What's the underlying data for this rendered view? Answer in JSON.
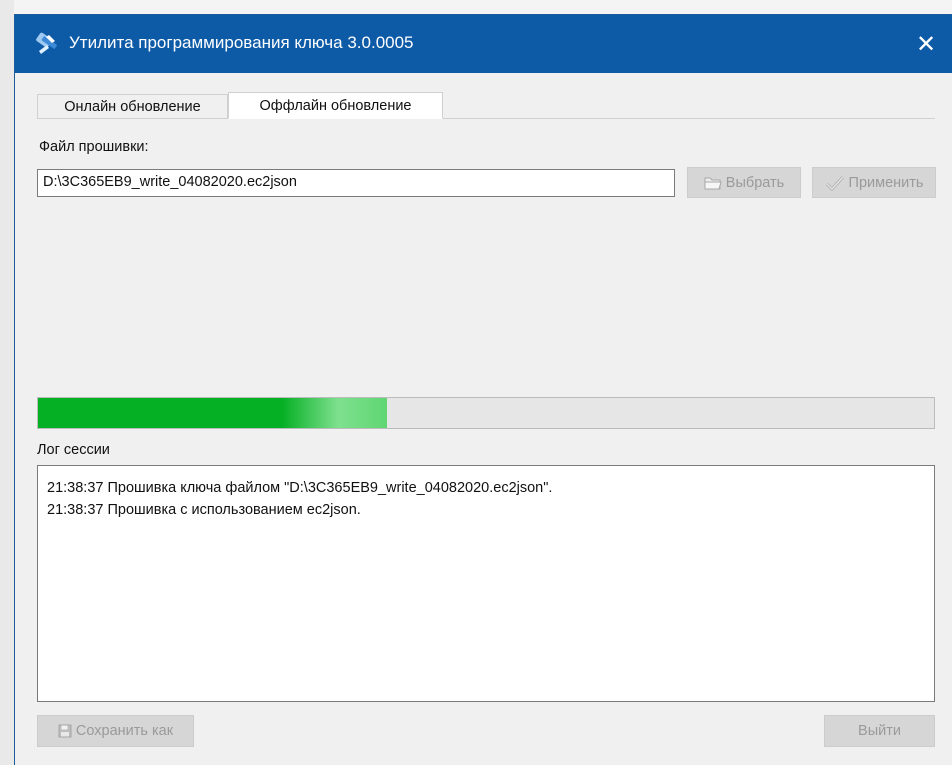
{
  "window": {
    "title": "Утилита программирования ключа 3.0.0005",
    "close_glyph": "✕"
  },
  "tabs": [
    {
      "label": "Онлайн обновление",
      "active": false
    },
    {
      "label": "Оффлайн обновление",
      "active": true
    }
  ],
  "firmware": {
    "label": "Файл прошивки:",
    "path": "D:\\3C365EB9_write_04082020.ec2json",
    "select_label": "Выбрать",
    "apply_label": "Применить"
  },
  "progress": {
    "percent": 39
  },
  "log": {
    "label": "Лог сессии",
    "lines": [
      "21:38:37 Прошивка ключа файлом \"D:\\3C365EB9_write_04082020.ec2json\".",
      "21:38:37 Прошивка с использованием ec2json."
    ]
  },
  "footer": {
    "save_label": "Сохранить как",
    "exit_label": "Выйти"
  },
  "colors": {
    "titlebar": "#0d5aa7",
    "progress": "#06b025"
  }
}
